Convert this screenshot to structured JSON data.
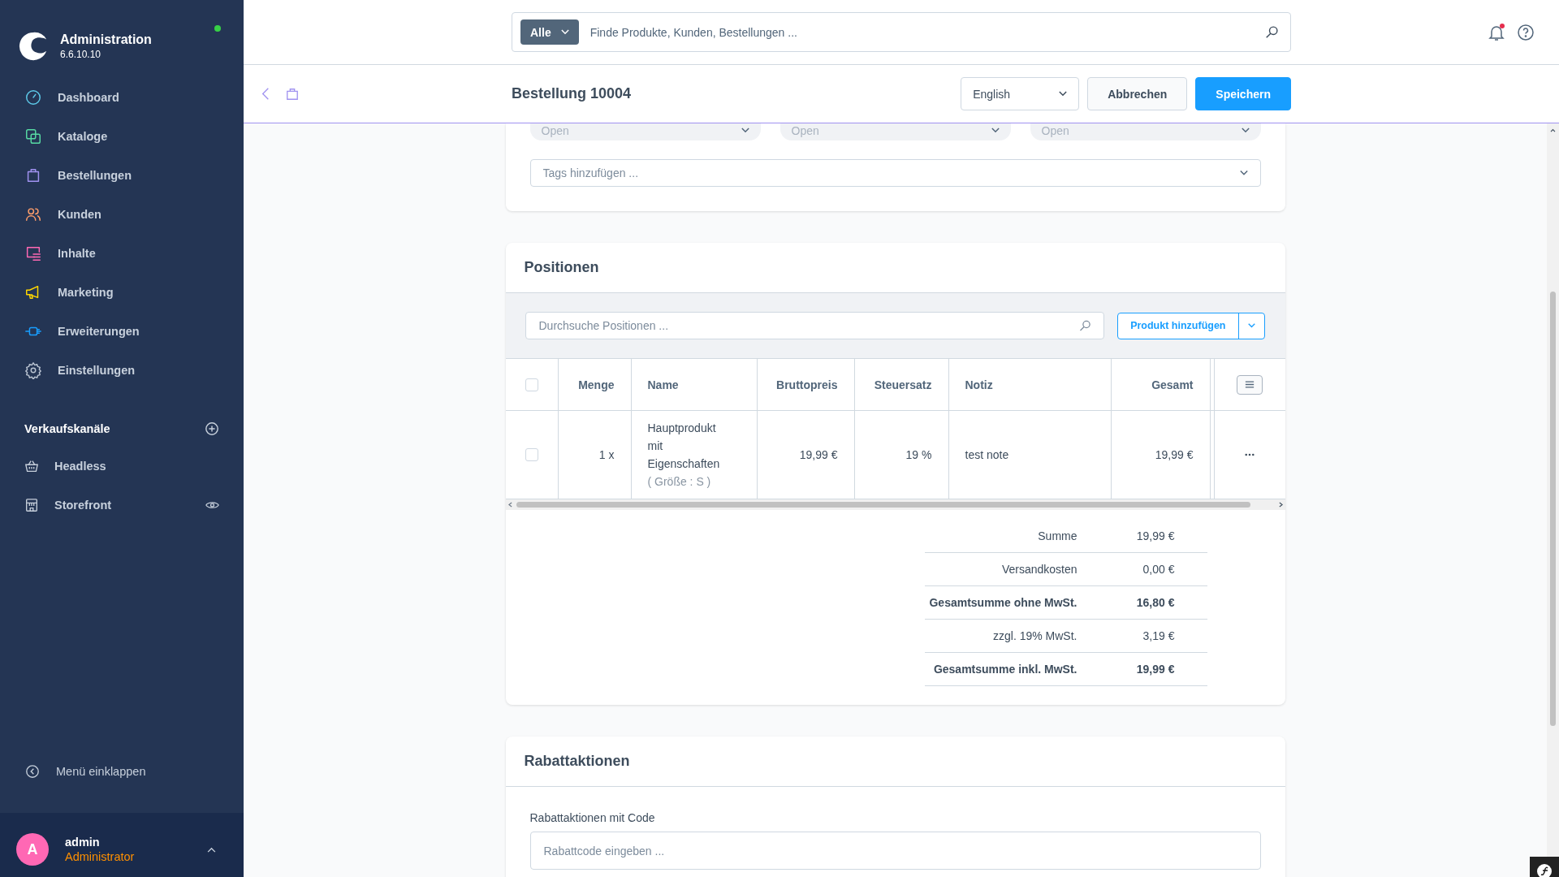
{
  "sidebar": {
    "app_name": "Administration",
    "version": "6.6.10.10",
    "online": true,
    "nav_items": [
      {
        "label": "Dashboard",
        "color": "#5dc9e8"
      },
      {
        "label": "Kataloge",
        "color": "#57d9a3"
      },
      {
        "label": "Bestellungen",
        "color": "#a092f0"
      },
      {
        "label": "Kunden",
        "color": "#ff9e6b"
      },
      {
        "label": "Inhalte",
        "color": "#ff68b4"
      },
      {
        "label": "Marketing",
        "color": "#ffd700"
      },
      {
        "label": "Erweiterungen",
        "color": "#189eff"
      },
      {
        "label": "Einstellungen",
        "color": "#b8c2d0"
      }
    ],
    "sales_channels_title": "Verkaufskanäle",
    "sales_channels": [
      {
        "label": "Headless",
        "kind": "api"
      },
      {
        "label": "Storefront",
        "kind": "storefront"
      }
    ],
    "collapse_label": "Menü einklappen",
    "user": {
      "initial": "A",
      "name": "admin",
      "role": "Administrator"
    }
  },
  "search": {
    "type_filter": "Alle",
    "placeholder": "Finde Produkte, Kunden, Bestellungen ..."
  },
  "notifications": {
    "unread": true
  },
  "smart_bar": {
    "title": "Bestellung 10004",
    "language": "English",
    "buttons": [
      {
        "label": "Abbrechen",
        "kind": "secondary"
      },
      {
        "label": "Speichern",
        "kind": "primary"
      }
    ]
  },
  "status_selects": [
    {
      "value": "Open"
    },
    {
      "value": "Open"
    },
    {
      "value": "Open"
    }
  ],
  "tags": {
    "placeholder": "Tags hinzufügen ..."
  },
  "positions": {
    "title": "Positionen",
    "search_placeholder": "Durchsuche Positionen ...",
    "add_button": "Produkt hinzufügen",
    "all_selected": false,
    "columns": [
      "Menge",
      "Name",
      "Bruttopreis",
      "Steuersatz",
      "Notiz",
      "Gesamt"
    ],
    "rows": [
      {
        "selected": false,
        "quantity": "1 x",
        "name": "Hauptprodukt mit Eigenschaften",
        "variant": "( Größe : S )",
        "gross_price": "19,99 €",
        "tax_rate": "19 %",
        "note": "test note",
        "total": "19,99 €"
      }
    ],
    "totals": [
      {
        "label": "Summe",
        "value": "19,99 €",
        "emphasis": false
      },
      {
        "label": "Versandkosten",
        "value": "0,00 €",
        "emphasis": false
      },
      {
        "label": "Gesamtsumme ohne MwSt.",
        "value": "16,80 €",
        "emphasis": true
      },
      {
        "label": "zzgl. 19% MwSt.",
        "value": "3,19 €",
        "emphasis": false
      },
      {
        "label": "Gesamtsumme inkl. MwSt.",
        "value": "19,99 €",
        "emphasis": true
      }
    ]
  },
  "promotions": {
    "title": "Rabattaktionen",
    "code_label": "Rabattaktionen mit Code",
    "code_placeholder": "Rabattcode eingeben ..."
  }
}
